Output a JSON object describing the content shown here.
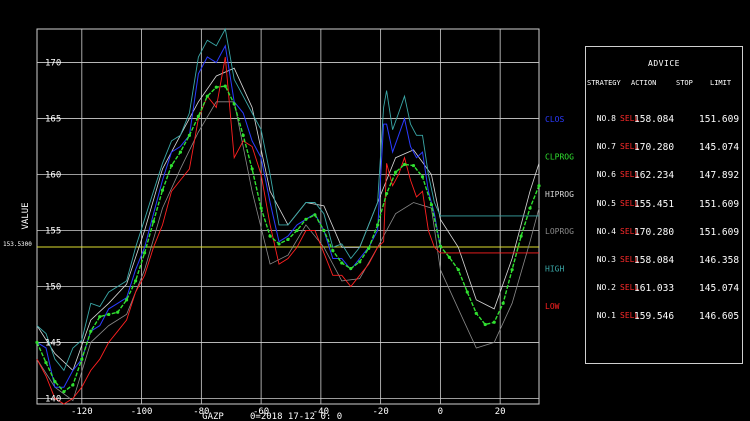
{
  "chart_data": {
    "type": "line",
    "xlabel": "GAZP",
    "ylabel": "VALUE",
    "subtitle": "0=2018 17-12  0: 0",
    "xlim": [
      -135,
      33
    ],
    "ylim": [
      139.5,
      173
    ],
    "xticks": [
      -120,
      -100,
      -80,
      -60,
      -40,
      -20,
      0,
      20
    ],
    "yticks": [
      140,
      145,
      150,
      155,
      160,
      165,
      170
    ],
    "grid": true,
    "reference_line": {
      "value": 153.53,
      "label": "153.5300",
      "color": "#dede30"
    },
    "legend": [
      {
        "name": "CLOS",
        "color": "#2b3bff"
      },
      {
        "name": "CLPROG",
        "color": "#30e030"
      },
      {
        "name": "HIPROG",
        "color": "#d8d8d8"
      },
      {
        "name": "LOPROG",
        "color": "#8a8a8a"
      },
      {
        "name": "HIGH",
        "color": "#3aa7a7"
      },
      {
        "name": "LOW",
        "color": "#ff2020"
      }
    ],
    "series": {
      "clprog": {
        "x": [
          -135,
          -132,
          -129,
          -126,
          -123,
          -120,
          -117,
          -114,
          -111,
          -108,
          -105,
          -102,
          -99,
          -96,
          -93,
          -90,
          -87,
          -84,
          -81,
          -78,
          -75,
          -72,
          -69,
          -66,
          -63,
          -60,
          -57,
          -54,
          -51,
          -48,
          -45,
          -42,
          -39,
          -36,
          -33,
          -30,
          -27,
          -24,
          -21,
          -18,
          -15,
          -12,
          -9,
          -6,
          -3,
          0,
          3,
          6,
          9,
          12,
          15,
          18,
          21,
          24,
          27,
          30,
          33
        ],
        "y": [
          145,
          143.2,
          141.5,
          140.6,
          141.2,
          143.5,
          146,
          147.3,
          147.5,
          147.7,
          148.8,
          150.5,
          153,
          155.8,
          158.6,
          160.8,
          162,
          163.5,
          165.2,
          167,
          167.8,
          167.9,
          166.3,
          163.5,
          160.5,
          157,
          154.5,
          153.8,
          154.2,
          155,
          156,
          156.4,
          155,
          153.2,
          152.1,
          151.6,
          152.2,
          153.4,
          155.5,
          158.3,
          160.2,
          160.9,
          160.8,
          159.8,
          157.3,
          153.6,
          152.6,
          151.5,
          149.5,
          147.6,
          146.6,
          146.8,
          148.5,
          151.5,
          154.5,
          157,
          159
        ]
      },
      "hiprog": {
        "x": [
          -135,
          -129,
          -123,
          -117,
          -111,
          -105,
          -99,
          -93,
          -87,
          -81,
          -75,
          -69,
          -63,
          -57,
          -51,
          -45,
          -39,
          -33,
          -27,
          -21,
          -15,
          -9,
          -3,
          0,
          6,
          12,
          18,
          24,
          30,
          33
        ],
        "y": [
          146.5,
          144,
          142.5,
          147,
          148.5,
          150.2,
          155,
          160.5,
          163.5,
          166.5,
          168.8,
          169.5,
          166,
          158.5,
          155.5,
          157.5,
          157.2,
          153.5,
          153.5,
          157.5,
          161.5,
          162.2,
          160,
          156,
          153.5,
          148.8,
          148,
          152.5,
          158.5,
          161
        ]
      },
      "loprog": {
        "x": [
          -135,
          -129,
          -123,
          -117,
          -111,
          -105,
          -99,
          -93,
          -87,
          -81,
          -75,
          -69,
          -63,
          -57,
          -51,
          -45,
          -39,
          -33,
          -27,
          -21,
          -15,
          -9,
          -3,
          0,
          6,
          12,
          18,
          24,
          30,
          33
        ],
        "y": [
          143.5,
          141,
          139.8,
          145,
          146.5,
          147.5,
          151.5,
          157,
          160.5,
          163.8,
          166.5,
          166.5,
          158.5,
          152,
          152.8,
          155.5,
          153.5,
          150.5,
          150.7,
          153.5,
          156.5,
          157.5,
          157,
          151.5,
          148,
          144.5,
          145,
          148.5,
          154,
          157
        ]
      },
      "high": {
        "x": [
          -135,
          -132,
          -129,
          -126,
          -123,
          -120,
          -117,
          -114,
          -111,
          -108,
          -105,
          -102,
          -99,
          -96,
          -93,
          -90,
          -87,
          -84,
          -81,
          -78,
          -75,
          -72,
          -69,
          -66,
          -63,
          -60,
          -57,
          -54,
          -51,
          -48,
          -45,
          -42,
          -39,
          -36,
          -33,
          -30,
          -27,
          -24,
          -21,
          -19,
          -18,
          -16,
          -14,
          -12,
          -10,
          -8,
          -6,
          -4,
          -2,
          0,
          33
        ],
        "y": [
          146.5,
          145.8,
          143.5,
          142.5,
          144.5,
          145.2,
          148.5,
          148.2,
          149.5,
          150,
          150.5,
          153.5,
          156,
          158.5,
          161,
          163,
          163.5,
          165.5,
          170.5,
          172,
          171.5,
          173,
          168.5,
          167,
          165.5,
          164,
          160,
          155.5,
          155.5,
          156.5,
          157.5,
          157.5,
          156.5,
          153.5,
          153.8,
          152.5,
          153.5,
          155.5,
          157.5,
          166,
          167.5,
          164,
          165.5,
          167,
          164.5,
          163.5,
          163.5,
          160,
          157.5,
          156.3,
          156.3
        ]
      },
      "clos": {
        "x": [
          -135,
          -132,
          -129,
          -126,
          -123,
          -120,
          -117,
          -114,
          -111,
          -108,
          -105,
          -102,
          -99,
          -96,
          -93,
          -90,
          -87,
          -84,
          -81,
          -78,
          -75,
          -72,
          -69,
          -66,
          -63,
          -60,
          -57,
          -54,
          -51,
          -48,
          -45,
          -42,
          -39,
          -36,
          -33,
          -30,
          -27,
          -24,
          -21,
          -19,
          -18,
          -16,
          -14,
          -12,
          -10,
          -8,
          -6,
          -4,
          -2,
          0
        ],
        "y": [
          145,
          144.5,
          141,
          141,
          142.5,
          143.5,
          146,
          146.5,
          148,
          148.5,
          149,
          151.5,
          153.5,
          156.5,
          159.5,
          162,
          162.5,
          163.5,
          169,
          170.5,
          170,
          171.5,
          166.5,
          165.5,
          163,
          161.5,
          157.5,
          154,
          154.5,
          155.5,
          156,
          156.5,
          155,
          152.5,
          152.5,
          151.5,
          152.5,
          153.5,
          155,
          164.5,
          164.5,
          162,
          163.5,
          165,
          162.5,
          161.5,
          162,
          158.5,
          156.5,
          153.5
        ]
      },
      "low": {
        "x": [
          -135,
          -132,
          -129,
          -126,
          -123,
          -120,
          -117,
          -114,
          -111,
          -108,
          -105,
          -102,
          -99,
          -96,
          -93,
          -90,
          -87,
          -84,
          -81,
          -78,
          -75,
          -72,
          -69,
          -66,
          -63,
          -60,
          -57,
          -54,
          -51,
          -48,
          -45,
          -42,
          -39,
          -36,
          -33,
          -30,
          -27,
          -24,
          -21,
          -19,
          -18,
          -16,
          -14,
          -12,
          -10,
          -8,
          -6,
          -4,
          -2,
          0,
          33
        ],
        "y": [
          143.5,
          142,
          140,
          139.5,
          140,
          141,
          142.5,
          143.5,
          145,
          146,
          147,
          149.5,
          151,
          153.5,
          155.5,
          158.5,
          159.5,
          160.5,
          165,
          167,
          166,
          170.5,
          161.5,
          163,
          162.5,
          160,
          155.5,
          152,
          152.5,
          153.5,
          155,
          155,
          153,
          151,
          151,
          150,
          151,
          152,
          153.5,
          154,
          161,
          159,
          160,
          161.5,
          159.5,
          158,
          158.5,
          155,
          153.5,
          153,
          153
        ]
      }
    }
  },
  "chart_labels": {
    "ylabel": "VALUE",
    "xlabel": "GAZP",
    "subtitle": "0=2018 17-12  0: 0",
    "ref_label": "153.5300"
  },
  "advice": {
    "title": "ADVICE",
    "headers": {
      "strategy": "STRATEGY",
      "action": "ACTION",
      "stop": "STOP",
      "limit": "LIMIT"
    },
    "rows": [
      {
        "strategy": "NO.8",
        "action": "SELL",
        "stop": "158.084",
        "limit": "151.609"
      },
      {
        "strategy": "NO.7",
        "action": "SELL",
        "stop": "170.280",
        "limit": "145.074"
      },
      {
        "strategy": "NO.6",
        "action": "SELL",
        "stop": "162.234",
        "limit": "147.892"
      },
      {
        "strategy": "NO.5",
        "action": "SELL",
        "stop": "155.451",
        "limit": "151.609"
      },
      {
        "strategy": "NO.4",
        "action": "SELL",
        "stop": "170.280",
        "limit": "151.609"
      },
      {
        "strategy": "NO.3",
        "action": "SELL",
        "stop": "158.084",
        "limit": "146.358"
      },
      {
        "strategy": "NO.2",
        "action": "SELL",
        "stop": "161.033",
        "limit": "145.074"
      },
      {
        "strategy": "NO.1",
        "action": "SELL",
        "stop": "159.546",
        "limit": "146.605"
      }
    ]
  }
}
